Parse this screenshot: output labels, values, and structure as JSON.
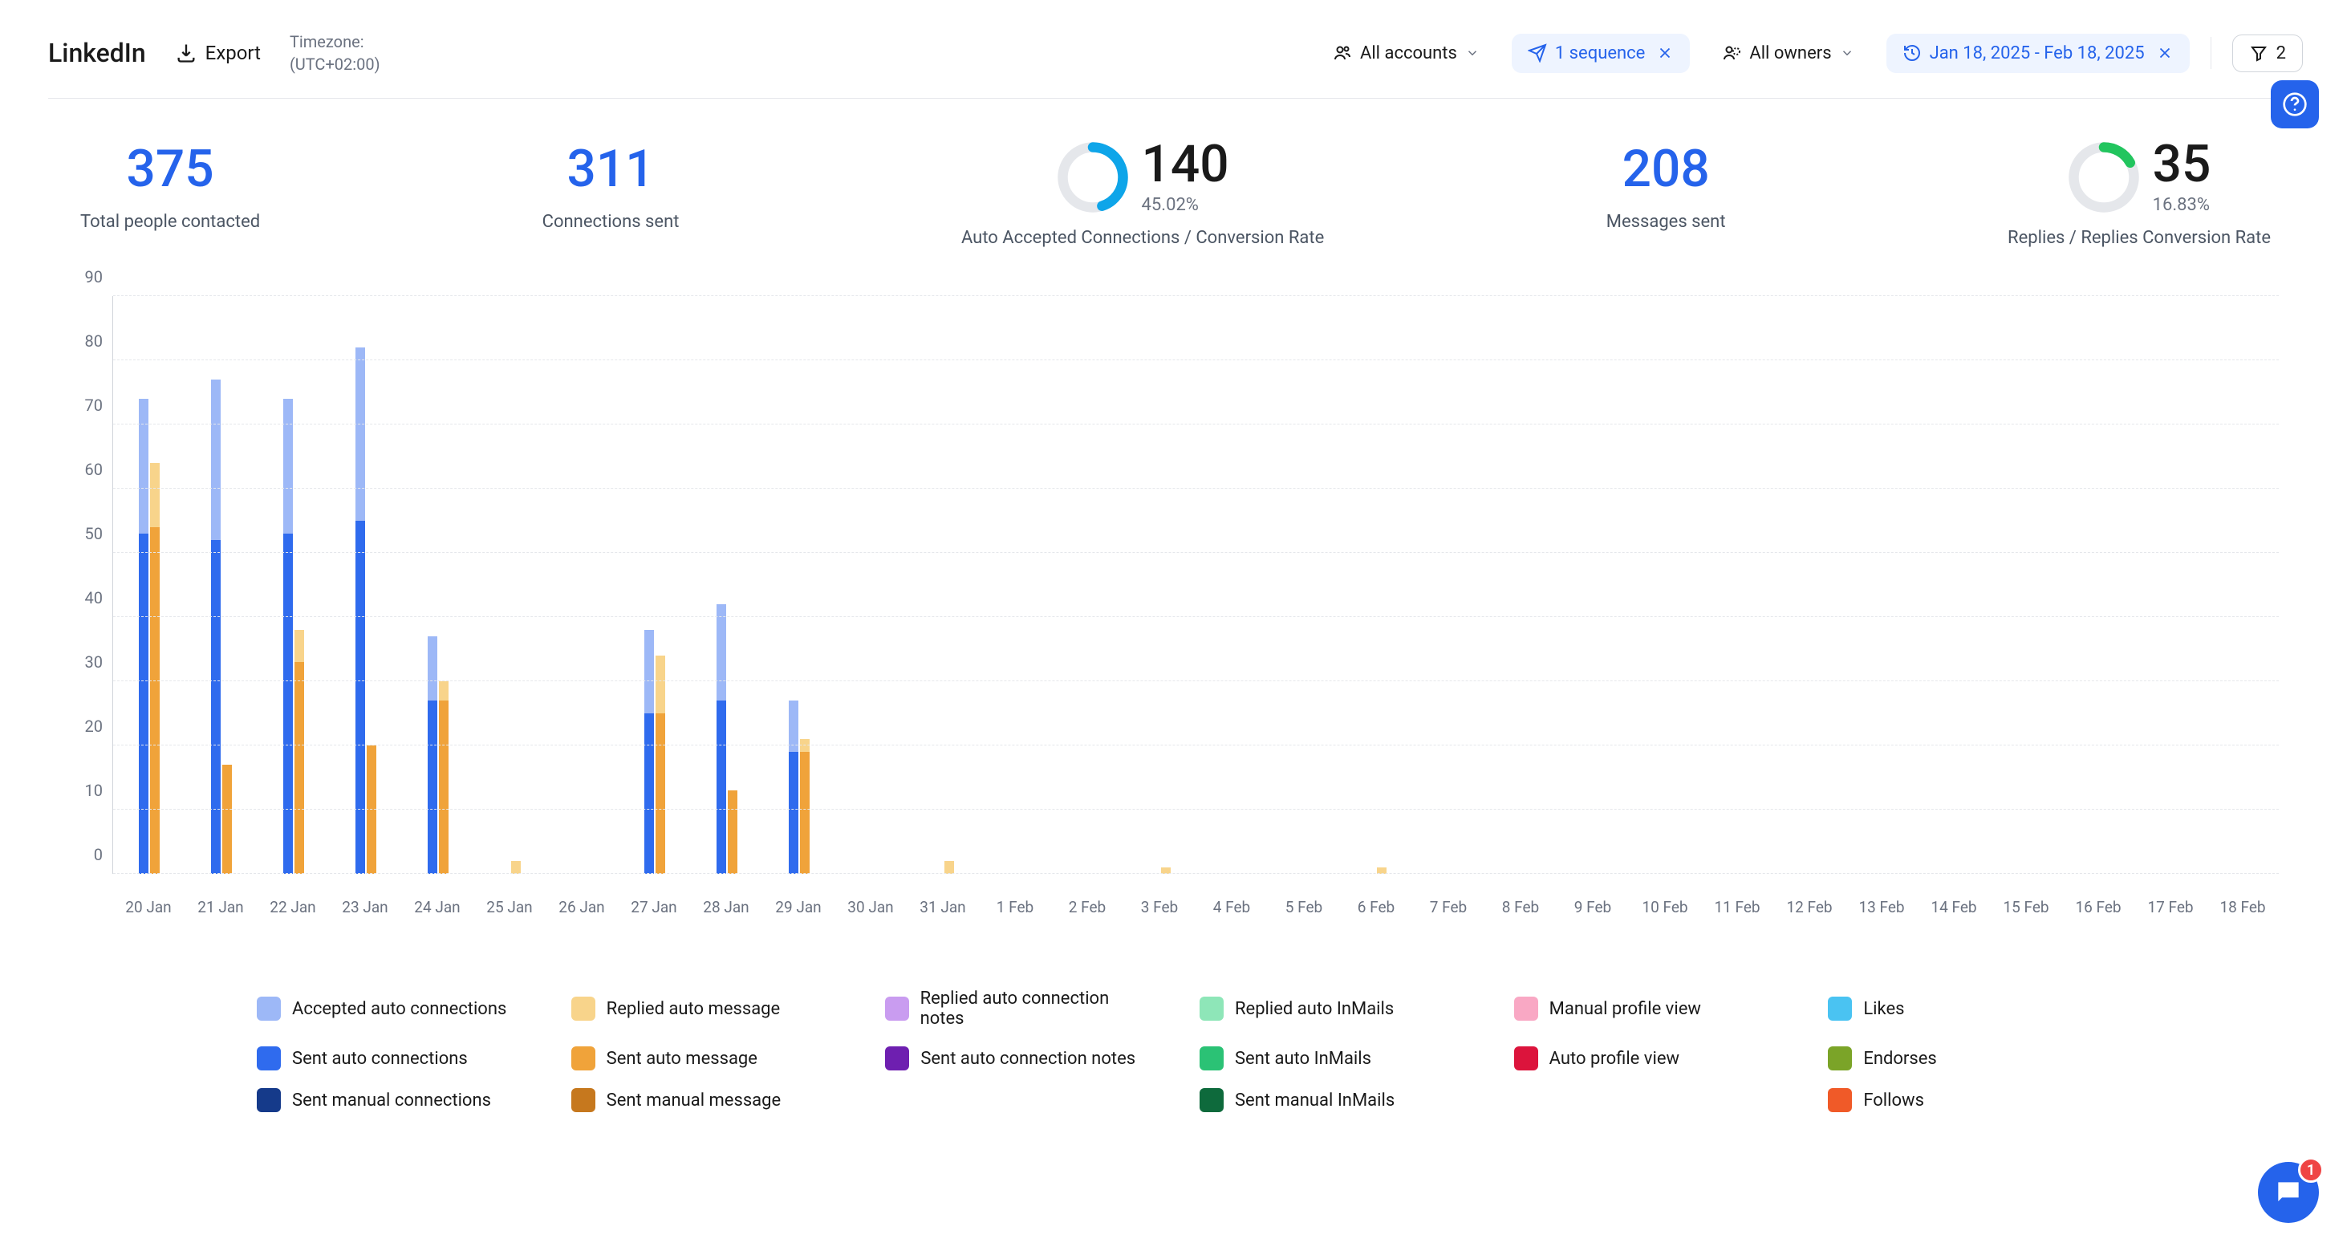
{
  "header": {
    "title": "LinkedIn",
    "export": "Export",
    "tz_label": "Timezone:",
    "tz_value": "(UTC+02:00)",
    "accounts": "All accounts",
    "sequence": "1 sequence",
    "owners": "All owners",
    "daterange": "Jan 18, 2025 - Feb 18, 2025",
    "filter_count": "2"
  },
  "stats": {
    "contacted": {
      "value": "375",
      "label": "Total people contacted"
    },
    "connections": {
      "value": "311",
      "label": "Connections sent"
    },
    "accepted": {
      "value": "140",
      "pct": "45.02%",
      "label": "Auto Accepted Connections / Conversion Rate"
    },
    "messages": {
      "value": "208",
      "label": "Messages sent"
    },
    "replies": {
      "value": "35",
      "pct": "16.83%",
      "label": "Replies / Replies Conversion Rate"
    }
  },
  "chart_data": {
    "type": "bar",
    "ylim": [
      0,
      90
    ],
    "yticks": [
      0,
      10,
      20,
      30,
      40,
      50,
      60,
      70,
      80,
      90
    ],
    "categories": [
      "20 Jan",
      "21 Jan",
      "22 Jan",
      "23 Jan",
      "24 Jan",
      "25 Jan",
      "26 Jan",
      "27 Jan",
      "28 Jan",
      "29 Jan",
      "30 Jan",
      "31 Jan",
      "1 Feb",
      "2 Feb",
      "3 Feb",
      "4 Feb",
      "5 Feb",
      "6 Feb",
      "7 Feb",
      "8 Feb",
      "9 Feb",
      "10 Feb",
      "11 Feb",
      "12 Feb",
      "13 Feb",
      "14 Feb",
      "15 Feb",
      "16 Feb",
      "17 Feb",
      "18 Feb"
    ],
    "series": [
      {
        "name": "Accepted auto connections",
        "color": "#9DB8F7",
        "values": [
          21,
          25,
          21,
          27,
          10,
          0,
          0,
          13,
          15,
          8,
          0,
          0,
          0,
          0,
          0,
          0,
          0,
          0,
          0,
          0,
          0,
          0,
          0,
          0,
          0,
          0,
          0,
          0,
          0,
          0
        ]
      },
      {
        "name": "Sent auto connections",
        "color": "#2F6BEE",
        "values": [
          53,
          52,
          53,
          55,
          27,
          0,
          0,
          25,
          27,
          19,
          0,
          0,
          0,
          0,
          0,
          0,
          0,
          0,
          0,
          0,
          0,
          0,
          0,
          0,
          0,
          0,
          0,
          0,
          0,
          0
        ]
      },
      {
        "name": "Sent manual connections",
        "color": "#153A8A",
        "values": [
          0,
          0,
          0,
          0,
          0,
          0,
          0,
          0,
          0,
          0,
          0,
          0,
          0,
          0,
          0,
          0,
          0,
          0,
          0,
          0,
          0,
          0,
          0,
          0,
          0,
          0,
          0,
          0,
          0,
          0
        ]
      },
      {
        "name": "Replied auto message",
        "color": "#F8D48B",
        "values": [
          10,
          0,
          5,
          0,
          3,
          2,
          0,
          9,
          0,
          2,
          0,
          2,
          0,
          0,
          1,
          0,
          0,
          1,
          0,
          0,
          0,
          0,
          0,
          0,
          0,
          0,
          0,
          0,
          0,
          0
        ]
      },
      {
        "name": "Sent auto message",
        "color": "#F0A33A",
        "values": [
          54,
          17,
          33,
          20,
          27,
          0,
          0,
          25,
          13,
          19,
          0,
          0,
          0,
          0,
          0,
          0,
          0,
          0,
          0,
          0,
          0,
          0,
          0,
          0,
          0,
          0,
          0,
          0,
          0,
          0
        ]
      },
      {
        "name": "Sent manual message",
        "color": "#C6781E",
        "values": [
          0,
          0,
          0,
          0,
          0,
          0,
          0,
          0,
          0,
          0,
          0,
          0,
          0,
          0,
          0,
          0,
          0,
          0,
          0,
          0,
          0,
          0,
          0,
          0,
          0,
          0,
          0,
          0,
          0,
          0
        ]
      },
      {
        "name": "Replied auto connection notes",
        "color": "#C99CF0",
        "values": [
          0,
          0,
          0,
          0,
          0,
          0,
          0,
          0,
          0,
          0,
          0,
          0,
          0,
          0,
          0,
          0,
          0,
          0,
          0,
          0,
          0,
          0,
          0,
          0,
          0,
          0,
          0,
          0,
          0,
          0
        ]
      },
      {
        "name": "Sent auto connection notes",
        "color": "#6E1FB0",
        "values": [
          0,
          0,
          0,
          0,
          0,
          0,
          0,
          0,
          0,
          0,
          0,
          0,
          0,
          0,
          0,
          0,
          0,
          0,
          0,
          0,
          0,
          0,
          0,
          0,
          0,
          0,
          0,
          0,
          0,
          0
        ]
      },
      {
        "name": "Replied auto InMails",
        "color": "#8EE6B8",
        "values": [
          0,
          0,
          0,
          0,
          0,
          0,
          0,
          0,
          0,
          0,
          0,
          0,
          0,
          0,
          0,
          0,
          0,
          0,
          0,
          0,
          0,
          0,
          0,
          0,
          0,
          0,
          0,
          0,
          0,
          0
        ]
      },
      {
        "name": "Sent auto InMails",
        "color": "#2BC275",
        "values": [
          0,
          0,
          0,
          0,
          0,
          0,
          0,
          0,
          0,
          0,
          0,
          0,
          0,
          0,
          0,
          0,
          0,
          0,
          0,
          0,
          0,
          0,
          0,
          0,
          0,
          0,
          0,
          0,
          0,
          0
        ]
      },
      {
        "name": "Sent manual InMails",
        "color": "#0E6A3C",
        "values": [
          0,
          0,
          0,
          0,
          0,
          0,
          0,
          0,
          0,
          0,
          0,
          0,
          0,
          0,
          0,
          0,
          0,
          0,
          0,
          0,
          0,
          0,
          0,
          0,
          0,
          0,
          0,
          0,
          0,
          0
        ]
      },
      {
        "name": "Manual profile view",
        "color": "#F9A8C4",
        "values": [
          0,
          0,
          0,
          0,
          0,
          0,
          0,
          0,
          0,
          0,
          0,
          0,
          0,
          0,
          0,
          0,
          0,
          0,
          0,
          0,
          0,
          0,
          0,
          0,
          0,
          0,
          0,
          0,
          0,
          0
        ]
      },
      {
        "name": "Auto profile view",
        "color": "#DC143C",
        "values": [
          0,
          0,
          0,
          0,
          0,
          0,
          0,
          0,
          0,
          0,
          0,
          0,
          0,
          0,
          0,
          0,
          0,
          0,
          0,
          0,
          0,
          0,
          0,
          0,
          0,
          0,
          0,
          0,
          0,
          0
        ]
      },
      {
        "name": "Likes",
        "color": "#4AC3F2",
        "values": [
          0,
          0,
          0,
          0,
          0,
          0,
          0,
          0,
          0,
          0,
          0,
          0,
          0,
          0,
          0,
          0,
          0,
          0,
          0,
          0,
          0,
          0,
          0,
          0,
          0,
          0,
          0,
          0,
          0,
          0
        ]
      },
      {
        "name": "Endorses",
        "color": "#7BA428",
        "values": [
          0,
          0,
          0,
          0,
          0,
          0,
          0,
          0,
          0,
          0,
          0,
          0,
          0,
          0,
          0,
          0,
          0,
          0,
          0,
          0,
          0,
          0,
          0,
          0,
          0,
          0,
          0,
          0,
          0,
          0
        ]
      },
      {
        "name": "Follows",
        "color": "#F05A28",
        "values": [
          0,
          0,
          0,
          0,
          0,
          0,
          0,
          0,
          0,
          0,
          0,
          0,
          0,
          0,
          0,
          0,
          0,
          0,
          0,
          0,
          0,
          0,
          0,
          0,
          0,
          0,
          0,
          0,
          0,
          0
        ]
      }
    ],
    "stacks": [
      [
        "Sent auto connections",
        "Accepted auto connections"
      ],
      [
        "Sent auto message",
        "Replied auto message"
      ]
    ]
  },
  "legend_order": [
    "Accepted auto connections",
    "Replied auto message",
    "Replied auto connection notes",
    "Replied auto InMails",
    "Manual profile view",
    "Likes",
    "Sent auto connections",
    "Sent auto message",
    "Sent auto connection notes",
    "Sent auto InMails",
    "Auto profile view",
    "Endorses",
    "Sent manual connections",
    "Sent manual message",
    "",
    "Sent manual InMails",
    "",
    "Follows"
  ],
  "chat_badge": "1"
}
